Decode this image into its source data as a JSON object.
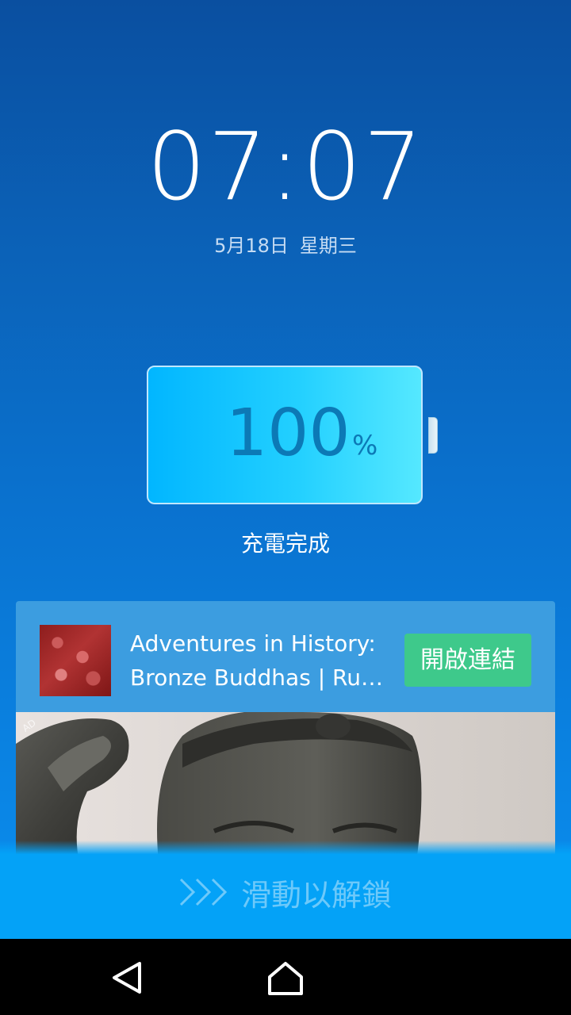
{
  "lockscreen": {
    "time": "07:07",
    "date": "5月18日",
    "weekday": "星期三"
  },
  "battery": {
    "level_percent": 100,
    "value_text": "100",
    "unit": "%",
    "status": "充電完成"
  },
  "ad": {
    "title_line1": "Adventures in History:",
    "title_line2": "Bronze Buddhas | Ru…",
    "button_label": "開啟連結",
    "tag": "AD",
    "button_color": "#3ec98b"
  },
  "unlock": {
    "label": "滑動以解鎖",
    "icon": "chevron-right-triple-icon"
  },
  "navbar": {
    "back_icon": "back-triangle-icon",
    "home_icon": "home-icon"
  }
}
